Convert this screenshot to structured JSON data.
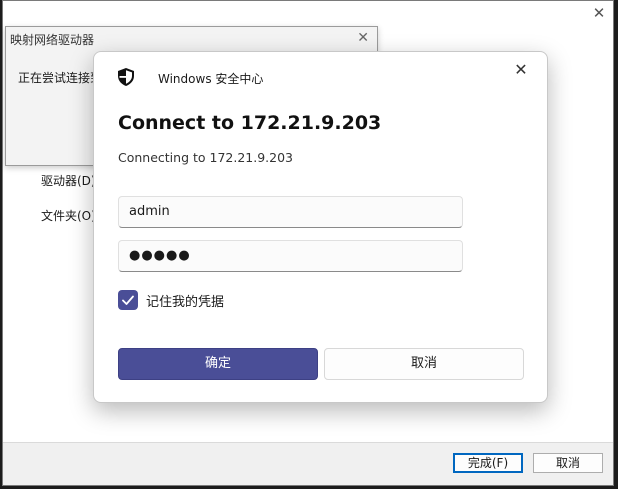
{
  "wizard": {
    "drive_label": "驱动器(D)",
    "folder_label": "文件夹(O)",
    "finish_button": "完成(F)",
    "cancel_button": "取消"
  },
  "connecting_dialog": {
    "title": "映射网络驱动器",
    "message": "正在尝试连接到"
  },
  "credential_dialog": {
    "app_name": "Windows 安全中心",
    "heading": "Connect to 172.21.9.203",
    "subheading": "Connecting to 172.21.9.203",
    "username_value": "admin",
    "password_value": "●●●●●",
    "remember_label": "记住我的凭据",
    "remember_checked": true,
    "ok_button": "确定",
    "cancel_button": "取消"
  },
  "colors": {
    "accent": "#4a4e97"
  }
}
